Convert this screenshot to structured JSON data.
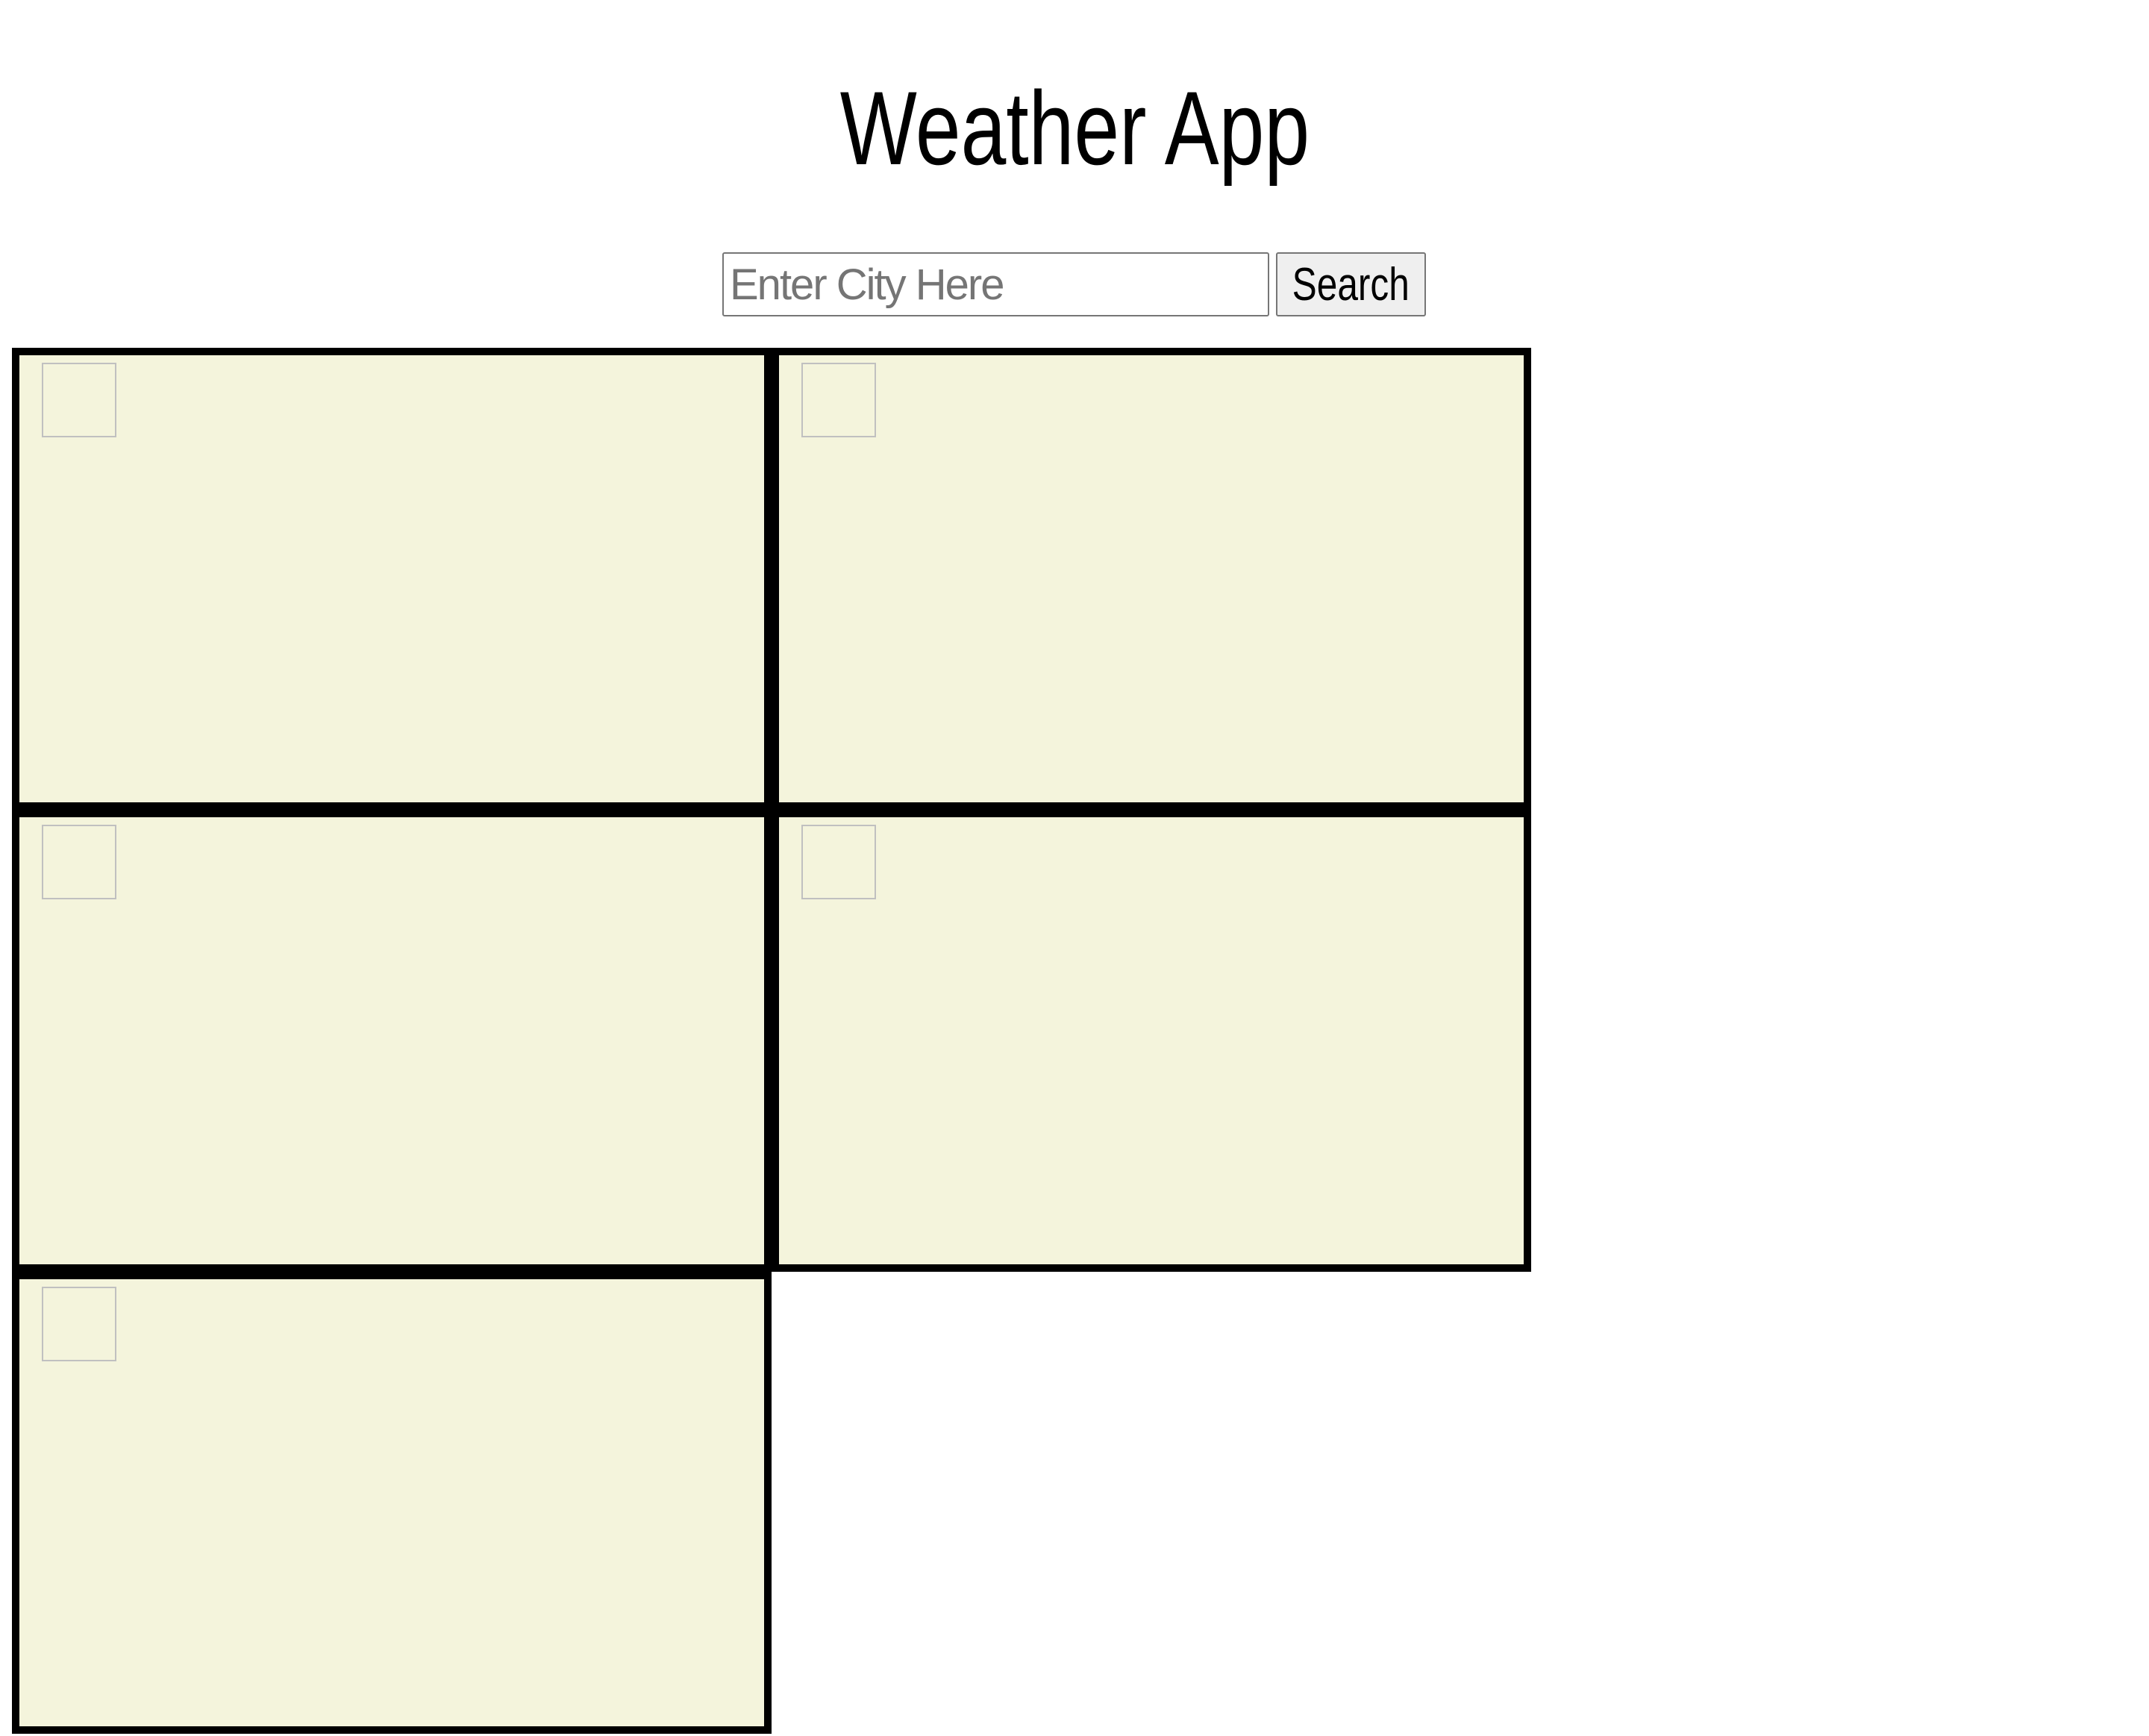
{
  "header": {
    "title": "Weather App"
  },
  "search": {
    "placeholder": "Enter City Here",
    "value": "",
    "button_label": "Search"
  },
  "colors": {
    "card_background": "#f4f4dc",
    "card_border": "#000000"
  },
  "forecast_cards": [
    {
      "icon": "weather-icon-broken-image"
    },
    {
      "icon": "weather-icon-broken-image"
    },
    {
      "icon": "weather-icon-broken-image"
    },
    {
      "icon": "weather-icon-broken-image"
    },
    {
      "icon": "weather-icon-broken-image"
    }
  ]
}
